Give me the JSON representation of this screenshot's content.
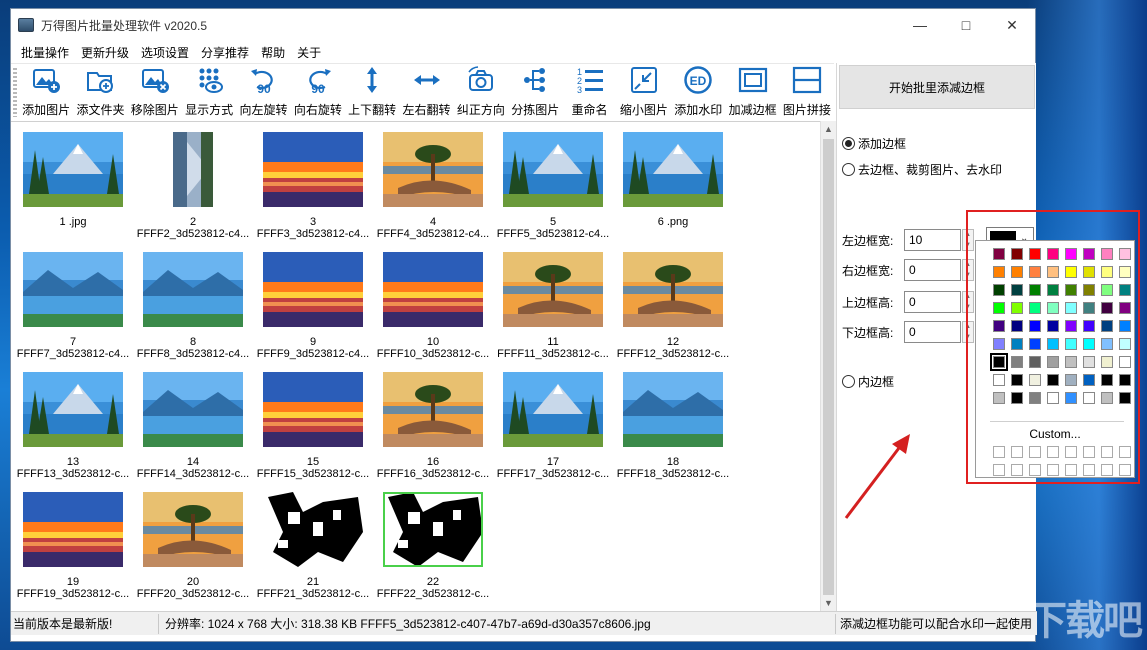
{
  "window": {
    "title": "万得图片批量处理软件 v2020.5"
  },
  "menu": [
    "批量操作",
    "更新升级",
    "选项设置",
    "分享推荐",
    "帮助",
    "关于"
  ],
  "toolbar": [
    {
      "label": "添加图片",
      "icon": "add-image-icon"
    },
    {
      "label": "添文件夹",
      "icon": "add-folder-icon"
    },
    {
      "label": "移除图片",
      "icon": "remove-image-icon"
    },
    {
      "label": "显示方式",
      "icon": "view-mode-icon"
    },
    {
      "label": "向左旋转",
      "icon": "rotate-left-icon",
      "glyph": "90"
    },
    {
      "label": "向右旋转",
      "icon": "rotate-right-icon",
      "glyph": "90"
    },
    {
      "label": "上下翻转",
      "icon": "flip-vertical-icon"
    },
    {
      "label": "左右翻转",
      "icon": "flip-horizontal-icon"
    },
    {
      "label": "纠正方向",
      "icon": "correct-orientation-icon"
    },
    {
      "label": "分拣图片",
      "icon": "sort-images-icon"
    },
    {
      "label": "重命名",
      "icon": "rename-icon"
    },
    {
      "label": "缩小图片",
      "icon": "shrink-image-icon"
    },
    {
      "label": "添加水印",
      "icon": "watermark-icon"
    },
    {
      "label": "加减边框",
      "icon": "border-icon"
    },
    {
      "label": "图片拼接",
      "icon": "stitch-icon"
    }
  ],
  "images": [
    {
      "num": "1 .jpg",
      "name": "",
      "kind": "lake"
    },
    {
      "num": "2",
      "name": "FFFF2_3d523812-c4...",
      "kind": "rotated"
    },
    {
      "num": "3",
      "name": "FFFF3_3d523812-c4...",
      "kind": "sunset"
    },
    {
      "num": "4",
      "name": "FFFF4_3d523812-c4...",
      "kind": "tree"
    },
    {
      "num": "5",
      "name": "FFFF5_3d523812-c4...",
      "kind": "lake"
    },
    {
      "num": "6 .png",
      "name": "",
      "kind": "lake"
    },
    {
      "num": "7",
      "name": "FFFF7_3d523812-c4...",
      "kind": "mist"
    },
    {
      "num": "8",
      "name": "FFFF8_3d523812-c4...",
      "kind": "mist"
    },
    {
      "num": "9",
      "name": "FFFF9_3d523812-c4...",
      "kind": "sunset"
    },
    {
      "num": "10",
      "name": "FFFF10_3d523812-c...",
      "kind": "sunset"
    },
    {
      "num": "11",
      "name": "FFFF11_3d523812-c...",
      "kind": "tree"
    },
    {
      "num": "12",
      "name": "FFFF12_3d523812-c...",
      "kind": "tree"
    },
    {
      "num": "13",
      "name": "FFFF13_3d523812-c...",
      "kind": "lake"
    },
    {
      "num": "14",
      "name": "FFFF14_3d523812-c...",
      "kind": "mist"
    },
    {
      "num": "15",
      "name": "FFFF15_3d523812-c...",
      "kind": "sunset"
    },
    {
      "num": "16",
      "name": "FFFF16_3d523812-c...",
      "kind": "tree"
    },
    {
      "num": "17",
      "name": "FFFF17_3d523812-c...",
      "kind": "lake"
    },
    {
      "num": "18",
      "name": "FFFF18_3d523812-c...",
      "kind": "mist"
    },
    {
      "num": "19",
      "name": "FFFF19_3d523812-c...",
      "kind": "sunset"
    },
    {
      "num": "20",
      "name": "FFFF20_3d523812-c...",
      "kind": "tree"
    },
    {
      "num": "21",
      "name": "FFFF21_3d523812-c...",
      "kind": "bw"
    },
    {
      "num": "22",
      "name": "FFFF22_3d523812-c...",
      "kind": "bw",
      "selected": true
    }
  ],
  "status": {
    "left": "当前版本是最新版!",
    "middle": "分辨率: 1024 x 768 大小: 318.38 KB FFFF5_3d523812-c407-47b7-a69d-d30a357c8606.jpg",
    "right": "添减边框功能可以配合水印一起使用"
  },
  "panel": {
    "start_button": "开始批里添减边框",
    "add_border": "添加边框",
    "remove_border": "去边框、裁剪图片、去水印",
    "left_width_label": "左边框宽:",
    "left_width_value": "10",
    "right_width_label": "右边框宽:",
    "right_width_value": "0",
    "top_height_label": "上边框高:",
    "top_height_value": "0",
    "bottom_height_label": "下边框高:",
    "bottom_height_value": "0",
    "inner_border": "内边框",
    "selected_color": "#000000"
  },
  "palette": {
    "colors": [
      "#800040",
      "#800000",
      "#ff0000",
      "#ff0080",
      "#ff00ff",
      "#c000c0",
      "#ff80c0",
      "#ffc0e0",
      "#ff8000",
      "#ff8000",
      "#ff8040",
      "#ffc080",
      "#ffff00",
      "#e0e000",
      "#ffff80",
      "#ffffc0",
      "#004000",
      "#004040",
      "#008000",
      "#008040",
      "#408000",
      "#808000",
      "#80ff80",
      "#008080",
      "#00ff00",
      "#80ff00",
      "#00ff80",
      "#80ffc0",
      "#80ffff",
      "#408080",
      "#400040",
      "#800080",
      "#400080",
      "#000080",
      "#0000ff",
      "#0000a0",
      "#8000ff",
      "#4000ff",
      "#004080",
      "#0080ff",
      "#8080ff",
      "#0080c0",
      "#0040ff",
      "#00c0ff",
      "#40ffff",
      "#00ffff",
      "#80c0ff",
      "#c0ffff",
      "#000000",
      "#808080",
      "#606060",
      "#a0a0a0",
      "#c0c0c0",
      "#e0e0e0",
      "#f0f0d0",
      "#ffffff",
      "#ffffff",
      "#000000",
      "#f0f0e0",
      "#000000",
      "#a0b0c0",
      "#0060c0",
      "#000000",
      "#000000",
      "#c0c0c0",
      "#000000",
      "#808080",
      "#ffffff",
      "#3090ff",
      "#ffffff",
      "#c0c0c0",
      "#000000"
    ],
    "custom_label": "Custom..."
  },
  "watermark_text": "下载吧"
}
